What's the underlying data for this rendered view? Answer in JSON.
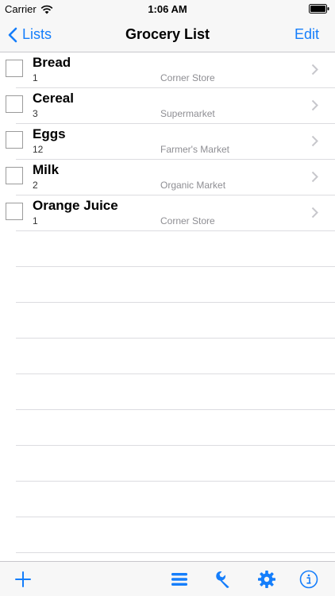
{
  "status_bar": {
    "carrier": "Carrier",
    "time": "1:06 AM"
  },
  "nav": {
    "back_label": "Lists",
    "title": "Grocery List",
    "edit_label": "Edit"
  },
  "items": [
    {
      "name": "Bread",
      "quantity": "1",
      "store": "Corner Store",
      "checked": false
    },
    {
      "name": "Cereal",
      "quantity": "3",
      "store": "Supermarket",
      "checked": false
    },
    {
      "name": "Eggs",
      "quantity": "12",
      "store": "Farmer's Market",
      "checked": false
    },
    {
      "name": "Milk",
      "quantity": "2",
      "store": "Organic Market",
      "checked": false
    },
    {
      "name": "Orange Juice",
      "quantity": "1",
      "store": "Corner Store",
      "checked": false
    }
  ],
  "toolbar": {
    "icons": [
      "plus-icon",
      "list-icon",
      "wrench-icon",
      "gear-icon",
      "info-icon"
    ]
  },
  "colors": {
    "accent": "#157efb",
    "separator": "#dcdce0",
    "secondary_text": "#8e8e93"
  }
}
